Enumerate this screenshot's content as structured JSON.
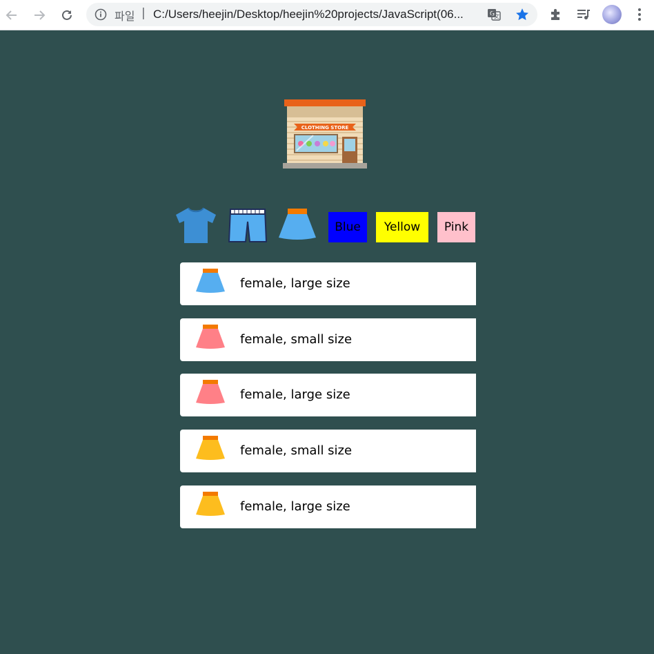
{
  "browser": {
    "scheme_label": "파일",
    "separator": "|",
    "url": "C:/Users/heejin/Desktop/heejin%20projects/JavaScript(06...",
    "bookmarked": true
  },
  "store": {
    "logo_sign": "CLOTHING STORE"
  },
  "filters": {
    "icons": [
      "tshirt-icon",
      "pants-icon",
      "skirt-icon"
    ],
    "colors": [
      {
        "label": "Blue",
        "color": "#0000ff"
      },
      {
        "label": "Yellow",
        "color": "#ffff00"
      },
      {
        "label": "Pink",
        "color": "#ffc0cb"
      }
    ]
  },
  "items": [
    {
      "text": "female, large size",
      "color": "#56aef0"
    },
    {
      "text": "female, small size",
      "color": "#ff8087"
    },
    {
      "text": "female, large size",
      "color": "#ff8087"
    },
    {
      "text": "female, small size",
      "color": "#fdbd1e"
    },
    {
      "text": "female, large size",
      "color": "#fdbd1e"
    }
  ],
  "colors": {
    "background": "#2f4f4f",
    "item_background": "#ffffff",
    "skirt_waistband": "#f37a00"
  }
}
